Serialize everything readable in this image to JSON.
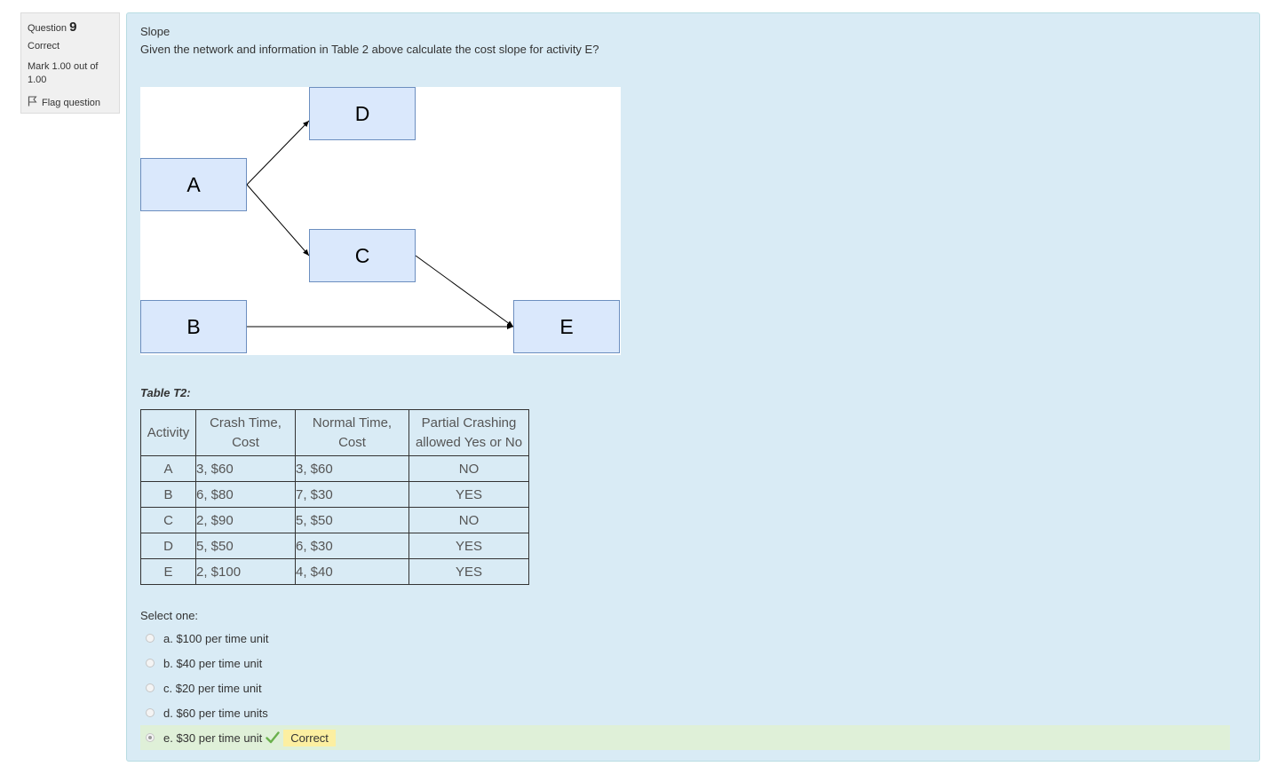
{
  "info": {
    "question_label": "Question",
    "question_number": "9",
    "state": "Correct",
    "grade": "Mark 1.00 out of 1.00",
    "flag_label": "Flag question"
  },
  "question": {
    "title": "Slope",
    "text": "Given the network and information in Table 2 above calculate the cost slope for activity E?"
  },
  "network": {
    "nodes": [
      "D",
      "A",
      "C",
      "B",
      "E"
    ]
  },
  "table": {
    "caption": "Table T2:",
    "headers": [
      "Activity",
      "Crash Time, Cost",
      "Normal Time, Cost",
      "Partial Crashing allowed Yes or No"
    ],
    "rows": [
      [
        "A",
        "3, $60",
        "3, $60",
        "NO"
      ],
      [
        "B",
        "6, $80",
        "7, $30",
        "YES"
      ],
      [
        "C",
        "2, $90",
        "5, $50",
        "NO"
      ],
      [
        "D",
        "5, $50",
        "6, $30",
        "YES"
      ],
      [
        "E",
        "2, $100",
        "4, $40",
        "YES"
      ]
    ]
  },
  "answers": {
    "prompt": "Select one:",
    "options": [
      "a. $100 per time unit",
      "b. $40 per time unit",
      "c. $20 per time unit",
      "d. $60 per time units",
      "e. $30 per time unit"
    ],
    "selected_index": 4,
    "feedback": "Correct"
  },
  "colors": {
    "panel_bg": "#d9ebf5",
    "node_fill": "#dae8fc",
    "node_border": "#6c8ebf",
    "correct_bg": "#dff0d8",
    "badge_bg": "#fcefa1",
    "check_green": "#6ab04c"
  }
}
